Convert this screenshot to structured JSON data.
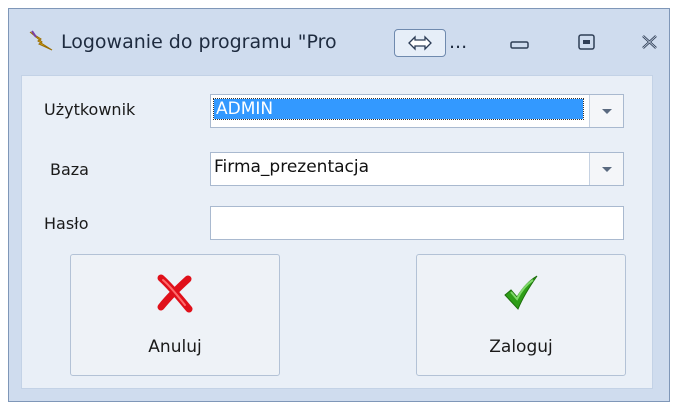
{
  "window": {
    "title": "Logowanie do programu \"Pro",
    "title_ellipsis": "...",
    "icon": "lightning-icon"
  },
  "controls": {
    "minimize_icon": "minimize-icon",
    "maximize_icon": "maximize-icon",
    "close_icon": "close-icon"
  },
  "form": {
    "user_label": "Użytkownik",
    "user_value": "ADMIN",
    "db_label": "Baza",
    "db_value": "Firma_prezentacja",
    "password_label": "Hasło",
    "password_value": ""
  },
  "buttons": {
    "cancel_label": "Anuluj",
    "cancel_icon": "red-x-icon",
    "login_label": "Zaloguj",
    "login_icon": "green-check-icon"
  },
  "colors": {
    "selection": "#3399ff",
    "cancel_icon": "#e0101a",
    "login_icon": "#2e9e18"
  }
}
